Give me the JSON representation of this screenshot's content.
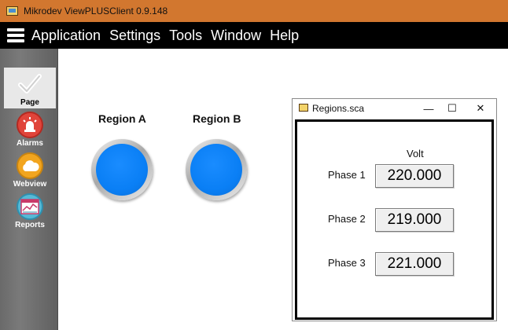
{
  "window": {
    "title": "Mikrodev ViewPLUSClient 0.9.148",
    "icon": "app-window-icon"
  },
  "menu": {
    "items": [
      "Application",
      "Settings",
      "Tools",
      "Window",
      "Help"
    ]
  },
  "sidebar": {
    "items": [
      {
        "label": "Page",
        "icon": "checkmark-icon",
        "active": true
      },
      {
        "label": "Alarms",
        "icon": "alarm-siren-icon",
        "color": "#e0443a"
      },
      {
        "label": "Webview",
        "icon": "cloud-icon",
        "color": "#f2a51f"
      },
      {
        "label": "Reports",
        "icon": "chart-report-icon",
        "color": "#57b9d6"
      }
    ]
  },
  "regions": [
    {
      "label": "Region A",
      "lamp_color": "#0a7ff5"
    },
    {
      "label": "Region B",
      "lamp_color": "#0a7ff5"
    }
  ],
  "child_window": {
    "title": "Regions.sca",
    "controls": {
      "minimize": "—",
      "maximize": "☐",
      "close": "✕"
    },
    "column_label": "Volt",
    "phases": [
      {
        "label": "Phase 1",
        "value": "220.000"
      },
      {
        "label": "Phase 2",
        "value": "219.000"
      },
      {
        "label": "Phase 3",
        "value": "221.000"
      }
    ]
  }
}
